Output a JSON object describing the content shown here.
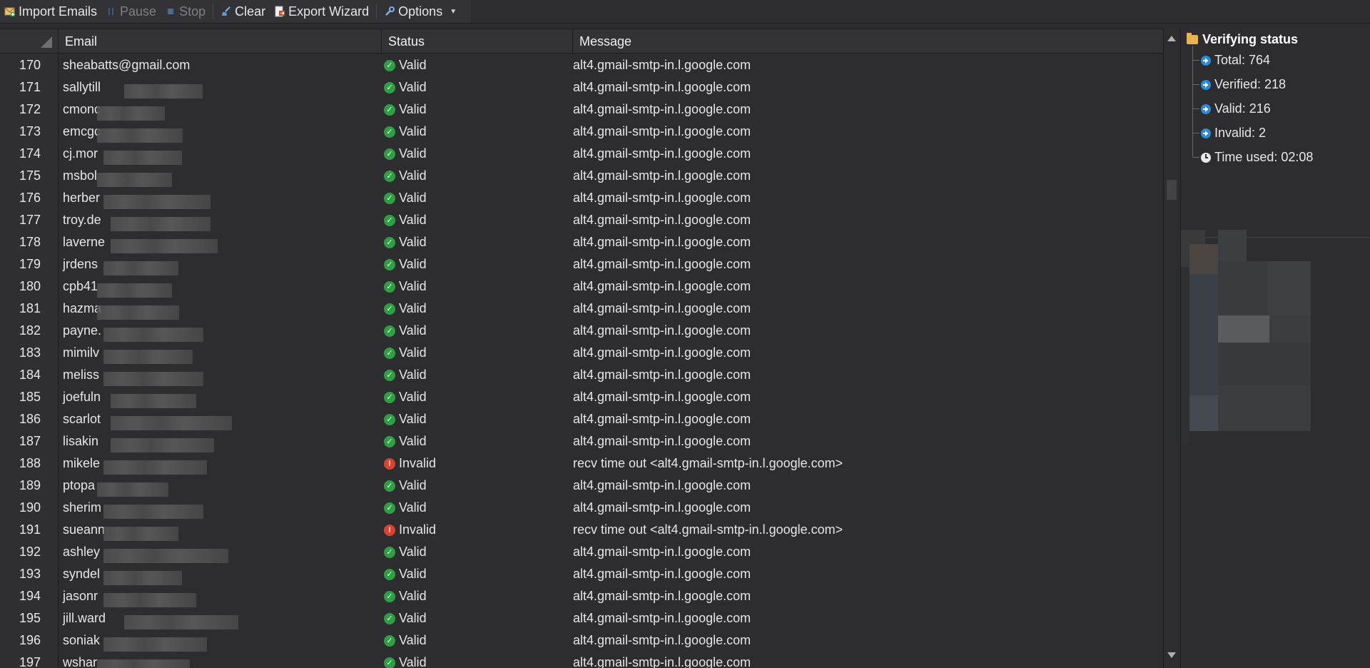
{
  "toolbar": {
    "import_label": "Import Emails",
    "pause_label": "Pause",
    "stop_label": "Stop",
    "clear_label": "Clear",
    "export_label": "Export Wizard",
    "options_label": "Options"
  },
  "grid": {
    "columns": [
      "Email",
      "Status",
      "Message"
    ],
    "rows": [
      {
        "n": "170",
        "email": "sheabatts@gmail.com",
        "status": "Valid",
        "msg": "alt4.gmail-smtp-in.l.google.com"
      },
      {
        "n": "171",
        "email": "sallytill",
        "status": "Valid",
        "msg": "alt4.gmail-smtp-in.l.google.com"
      },
      {
        "n": "172",
        "email": "cmonc",
        "status": "Valid",
        "msg": "alt4.gmail-smtp-in.l.google.com"
      },
      {
        "n": "173",
        "email": "emcgc",
        "status": "Valid",
        "msg": "alt4.gmail-smtp-in.l.google.com"
      },
      {
        "n": "174",
        "email": "cj.mor",
        "status": "Valid",
        "msg": "alt4.gmail-smtp-in.l.google.com"
      },
      {
        "n": "175",
        "email": "msbol",
        "status": "Valid",
        "msg": "alt4.gmail-smtp-in.l.google.com"
      },
      {
        "n": "176",
        "email": "herber",
        "status": "Valid",
        "msg": "alt4.gmail-smtp-in.l.google.com"
      },
      {
        "n": "177",
        "email": "troy.de",
        "status": "Valid",
        "msg": "alt4.gmail-smtp-in.l.google.com"
      },
      {
        "n": "178",
        "email": "laverne",
        "status": "Valid",
        "msg": "alt4.gmail-smtp-in.l.google.com"
      },
      {
        "n": "179",
        "email": "jrdens",
        "status": "Valid",
        "msg": "alt4.gmail-smtp-in.l.google.com"
      },
      {
        "n": "180",
        "email": "cpb41",
        "status": "Valid",
        "msg": "alt4.gmail-smtp-in.l.google.com"
      },
      {
        "n": "181",
        "email": "hazma",
        "status": "Valid",
        "msg": "alt4.gmail-smtp-in.l.google.com"
      },
      {
        "n": "182",
        "email": "payne.",
        "status": "Valid",
        "msg": "alt4.gmail-smtp-in.l.google.com"
      },
      {
        "n": "183",
        "email": "mimilv",
        "status": "Valid",
        "msg": "alt4.gmail-smtp-in.l.google.com"
      },
      {
        "n": "184",
        "email": "meliss",
        "status": "Valid",
        "msg": "alt4.gmail-smtp-in.l.google.com"
      },
      {
        "n": "185",
        "email": "joefuln",
        "status": "Valid",
        "msg": "alt4.gmail-smtp-in.l.google.com"
      },
      {
        "n": "186",
        "email": "scarlot",
        "status": "Valid",
        "msg": "alt4.gmail-smtp-in.l.google.com"
      },
      {
        "n": "187",
        "email": "lisakin",
        "status": "Valid",
        "msg": "alt4.gmail-smtp-in.l.google.com"
      },
      {
        "n": "188",
        "email": "mikele",
        "status": "Invalid",
        "msg": "recv time out <alt4.gmail-smtp-in.l.google.com>"
      },
      {
        "n": "189",
        "email": "ptopa",
        "status": "Valid",
        "msg": "alt4.gmail-smtp-in.l.google.com"
      },
      {
        "n": "190",
        "email": "sherim",
        "status": "Valid",
        "msg": "alt4.gmail-smtp-in.l.google.com"
      },
      {
        "n": "191",
        "email": "sueann",
        "status": "Invalid",
        "msg": "recv time out <alt4.gmail-smtp-in.l.google.com>"
      },
      {
        "n": "192",
        "email": "ashley",
        "status": "Valid",
        "msg": "alt4.gmail-smtp-in.l.google.com"
      },
      {
        "n": "193",
        "email": "syndel",
        "status": "Valid",
        "msg": "alt4.gmail-smtp-in.l.google.com"
      },
      {
        "n": "194",
        "email": "jasonr",
        "status": "Valid",
        "msg": "alt4.gmail-smtp-in.l.google.com"
      },
      {
        "n": "195",
        "email": "jill.ward",
        "status": "Valid",
        "msg": "alt4.gmail-smtp-in.l.google.com"
      },
      {
        "n": "196",
        "email": "soniak",
        "status": "Valid",
        "msg": "alt4.gmail-smtp-in.l.google.com"
      },
      {
        "n": "197",
        "email": "wshar",
        "status": "Valid",
        "msg": "alt4.gmail-smtp-in.l.google.com"
      }
    ]
  },
  "panel": {
    "title": "Verifying status",
    "total": "Total: 764",
    "verified": "Verified: 218",
    "valid": "Valid: 216",
    "invalid": "Invalid: 2",
    "time_used": "Time used: 02:08"
  },
  "colors": {
    "background": "#2d2d30",
    "valid_icon": "#2ea043",
    "invalid_icon": "#d9432e",
    "folder": "#e9b44c",
    "arrow_icon": "#2a8bd8"
  },
  "icons": {
    "import": "mail-add-icon",
    "pause": "pause-icon",
    "stop": "stop-icon",
    "clear": "broom-icon",
    "export": "export-document-icon",
    "options": "wrench-icon"
  }
}
